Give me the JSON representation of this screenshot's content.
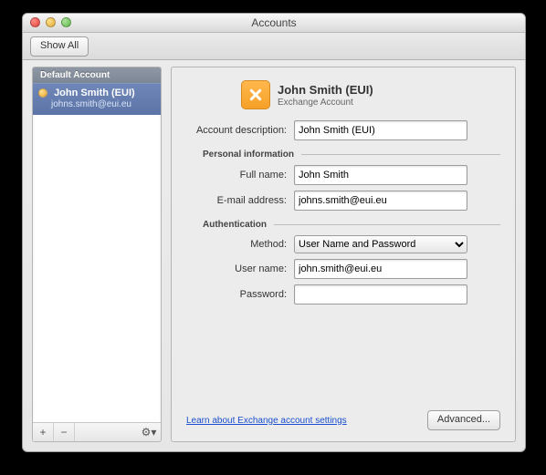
{
  "window": {
    "title": "Accounts"
  },
  "toolbar": {
    "show_all": "Show All"
  },
  "sidebar": {
    "group_label": "Default Account",
    "accounts": [
      {
        "name": "John Smith (EUI)",
        "email": "johns.smith@eui.eu"
      }
    ],
    "footer": {
      "add": "+",
      "remove": "−",
      "gear": "⚙▾"
    }
  },
  "detail": {
    "title": "John Smith (EUI)",
    "subtitle": "Exchange Account",
    "sections": {
      "personal": "Personal information",
      "auth": "Authentication"
    },
    "labels": {
      "description": "Account description:",
      "full_name": "Full name:",
      "email": "E-mail address:",
      "method": "Method:",
      "user_name": "User name:",
      "password": "Password:"
    },
    "values": {
      "description": "John Smith (EUI)",
      "full_name": "John Smith",
      "email": "johns.smith@eui.eu",
      "method": "User Name and Password",
      "user_name": "john.smith@eui.eu",
      "password": ""
    },
    "learn_link": "Learn about Exchange account settings",
    "advanced_btn": "Advanced..."
  }
}
